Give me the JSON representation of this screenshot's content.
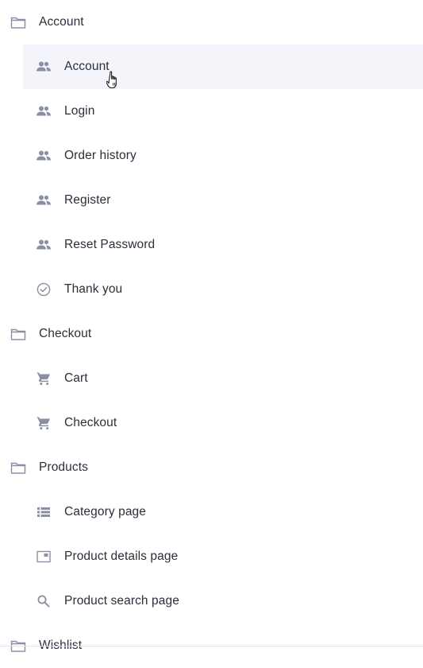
{
  "tree": {
    "groups": [
      {
        "label": "Account",
        "icon": "folder-icon",
        "items": [
          {
            "label": "Account",
            "icon": "people-icon"
          },
          {
            "label": "Login",
            "icon": "people-icon"
          },
          {
            "label": "Order history",
            "icon": "people-icon"
          },
          {
            "label": "Register",
            "icon": "people-icon"
          },
          {
            "label": "Reset Password",
            "icon": "people-icon"
          },
          {
            "label": "Thank you",
            "icon": "check-circle-icon"
          }
        ]
      },
      {
        "label": "Checkout",
        "icon": "folder-icon",
        "items": [
          {
            "label": "Cart",
            "icon": "cart-icon"
          },
          {
            "label": "Checkout",
            "icon": "cart-icon"
          }
        ]
      },
      {
        "label": "Products",
        "icon": "folder-icon",
        "items": [
          {
            "label": "Category page",
            "icon": "list-icon"
          },
          {
            "label": "Product details page",
            "icon": "product-card-icon"
          },
          {
            "label": "Product search page",
            "icon": "search-icon"
          }
        ]
      },
      {
        "label": "Wishlist",
        "icon": "folder-icon",
        "items": []
      }
    ]
  },
  "colors": {
    "icon": "#8a8fa3",
    "text": "#2b2f3a",
    "hover_bg": "#f4f4fb"
  }
}
